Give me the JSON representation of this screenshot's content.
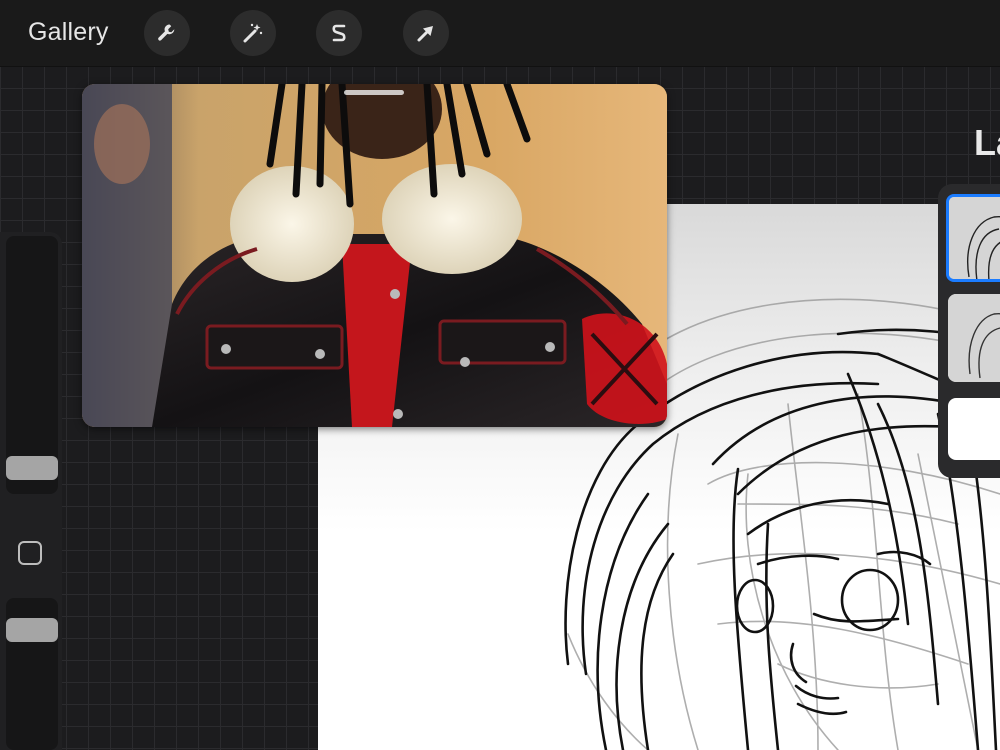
{
  "toolbar": {
    "gallery_label": "Gallery",
    "tools": [
      {
        "name": "actions",
        "icon": "wrench-icon"
      },
      {
        "name": "adjustments",
        "icon": "magic-wand-icon"
      },
      {
        "name": "selection",
        "icon": "selection-s-icon"
      },
      {
        "name": "transform",
        "icon": "arrow-cursor-icon"
      }
    ]
  },
  "layers_panel": {
    "title": "La",
    "layers": [
      {
        "kind": "sketch",
        "active": true
      },
      {
        "kind": "sketch",
        "active": false
      },
      {
        "kind": "background",
        "active": false
      }
    ]
  },
  "sidebar": {
    "brush_size_level": 0.05,
    "opacity_level": 0.55,
    "modify_icon": "square-icon"
  },
  "reference": {
    "content": "photo-reference-image"
  },
  "colors": {
    "accent": "#1b7cff",
    "toolbar": "#1a1a1a",
    "canvas": "#ffffff"
  }
}
